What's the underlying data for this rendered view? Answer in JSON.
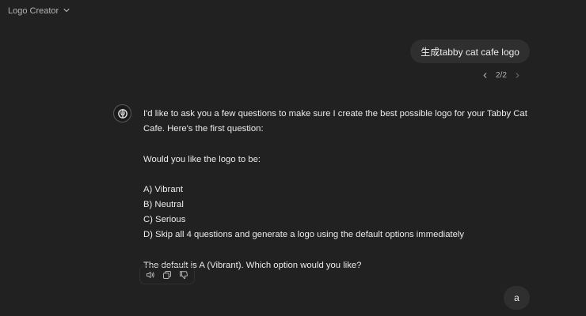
{
  "header": {
    "model_label": "Logo Creator"
  },
  "conversation": {
    "user_message": "生成tabby cat cafe logo",
    "pager": {
      "current": "2/2"
    },
    "assistant": {
      "paragraphs": {
        "intro": "I'd like to ask you a few questions to make sure I create the best possible logo for your Tabby Cat Cafe. Here's the first question:",
        "question": "Would you like the logo to be:",
        "option_a": "A) Vibrant",
        "option_b": "B) Neutral",
        "option_c": "C) Serious",
        "option_d": "D) Skip all 4 questions and generate a logo using the default options immediately",
        "closing": "The default is A (Vibrant). Which option would you like?"
      }
    },
    "user_reply": "a"
  },
  "icons": {
    "model_chevron": "chevron-down-icon",
    "pager_prev": "chevron-left-icon",
    "pager_next": "chevron-right-icon",
    "avatar": "logo-creator-icon",
    "read_aloud": "speaker-icon",
    "copy": "copy-icon",
    "dislike": "thumbs-down-icon"
  },
  "colors": {
    "background": "#212121",
    "bubble": "#2f2f2f",
    "text": "#ececec",
    "muted": "#b4b4b4"
  }
}
